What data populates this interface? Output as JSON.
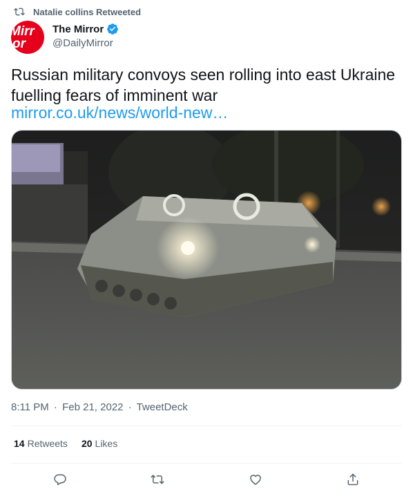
{
  "retweet": {
    "label": "Natalie collins Retweeted",
    "icon": "retweet-icon"
  },
  "author": {
    "name": "The Mirror",
    "handle": "@DailyMirror",
    "verified": true,
    "avatar_text": "Mirror",
    "avatar_color": "#e5001c"
  },
  "tweet": {
    "text": "Russian military convoys seen rolling into east Ukraine fuelling fears of imminent war",
    "link": "mirror.co.uk/news/world-new…"
  },
  "meta": {
    "time": "8:11 PM",
    "date": "Feb 21, 2022",
    "source": "TweetDeck",
    "separator": "·"
  },
  "stats": {
    "retweets_count": "14",
    "retweets_label": "Retweets",
    "likes_count": "20",
    "likes_label": "Likes"
  },
  "actions": [
    "reply-icon",
    "retweet-icon",
    "like-icon",
    "share-icon"
  ],
  "colors": {
    "link": "#1d9bf0",
    "secondary_text": "#536471",
    "verified": "#1d9bf0"
  }
}
